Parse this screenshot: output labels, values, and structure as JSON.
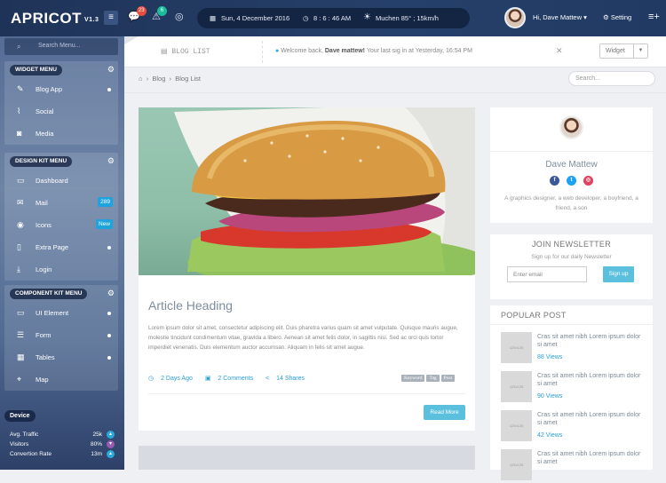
{
  "app": {
    "logo": "APRICOT",
    "version": "V1.3"
  },
  "topbar": {
    "notifications": [
      {
        "icon": "chat-icon",
        "count": "23",
        "color": "#e74c3c"
      },
      {
        "icon": "alert-icon",
        "count": "6",
        "color": "#1abc9c"
      },
      {
        "icon": "lifebuoy-icon"
      }
    ],
    "date": "Sun, 4 December 2016",
    "time": "8 : 6 : 46 AM",
    "weather": "Muchen  85° ; 15km/h",
    "user_greeting": "Hi, Dave Mattew",
    "setting_label": "Setting"
  },
  "sidebar": {
    "search_placeholder": "Search Menu...",
    "groups": [
      {
        "title": "WIDGET MENU",
        "items": [
          {
            "icon": "pencil-icon",
            "label": "Blog App",
            "marker": "dot"
          },
          {
            "icon": "rss-icon",
            "label": "Social"
          },
          {
            "icon": "camera-icon",
            "label": "Media"
          }
        ]
      },
      {
        "title": "DESIGN KIT MENU",
        "items": [
          {
            "icon": "monitor-icon",
            "label": "Dashboard"
          },
          {
            "icon": "mail-icon",
            "label": "Mail",
            "badge": "289"
          },
          {
            "icon": "eye-icon",
            "label": "Icons",
            "badge": "New"
          },
          {
            "icon": "file-icon",
            "label": "Extra Page",
            "marker": "dot"
          },
          {
            "icon": "download-icon",
            "label": "Login"
          }
        ]
      },
      {
        "title": "COMPONENT KIT MENU",
        "items": [
          {
            "icon": "desktop-icon",
            "label": "UI Element",
            "marker": "dot"
          },
          {
            "icon": "form-icon",
            "label": "Form",
            "marker": "dot"
          },
          {
            "icon": "grid-icon",
            "label": "Tables",
            "marker": "dot"
          },
          {
            "icon": "map-pin-icon",
            "label": "Map"
          }
        ]
      }
    ],
    "device": {
      "title": "Device",
      "stats": [
        {
          "label": "Avg. Traffic",
          "value": "25k"
        },
        {
          "label": "Visitors",
          "value": "80%"
        },
        {
          "label": "Convertion Rate",
          "value": "13m"
        }
      ]
    }
  },
  "subbar": {
    "page_label": "BLOG LIST",
    "welcome_prefix": "Welcome back,",
    "welcome_user": "Dave mattew!",
    "welcome_suffix": "Your last sig in at Yesterday, 16:54 PM",
    "widget_label": "Widget"
  },
  "breadcrumb": [
    "Blog",
    "Blog List"
  ],
  "page_search_placeholder": "Search...",
  "article": {
    "heading": "Article Heading",
    "body": "Lorem ipsum dolor sit amet, consectetur adipiscing elit. Duis pharetra varius quam sit amet vulputate. Quisque mauris augue, molestie tincidunt condimentum vitae, gravida a libero. Aenean sit amet felis dolor, in sagittis nisi. Sed ac orci quis tortor imperdiet venenatis. Duis elementum auctor accumsan. Aliquam in felis sit amet augue.",
    "date": "2 Days Ago",
    "comments": "2 Comments",
    "shares": "14 Shares",
    "tags": [
      "Keyword",
      "Tag",
      "Post"
    ],
    "read_more": "Read More"
  },
  "profile": {
    "name": "Dave Mattew",
    "bio": "A graphics designer, a web developer, a boyfriend, a friend, a son"
  },
  "newsletter": {
    "title": "JOIN NEWSLETTER",
    "subtitle": "Sign up for our daily Newsletter",
    "placeholder": "Enter email",
    "button": "Sign up"
  },
  "popular": {
    "title": "POPULAR POST",
    "thumb_text": "125x125",
    "posts": [
      {
        "title": "Cras sit amet nibh Lorem ipsum dolor si amet",
        "views": "88 Views"
      },
      {
        "title": "Cras sit amet nibh Lorem ipsum dolor si amet",
        "views": "90 Views"
      },
      {
        "title": "Cras sit amet nibh Lorem ipsum dolor si amet",
        "views": "42 Views"
      },
      {
        "title": "Cras sit amet nibh Lorem ipsum dolor si amet",
        "views": ""
      }
    ]
  }
}
